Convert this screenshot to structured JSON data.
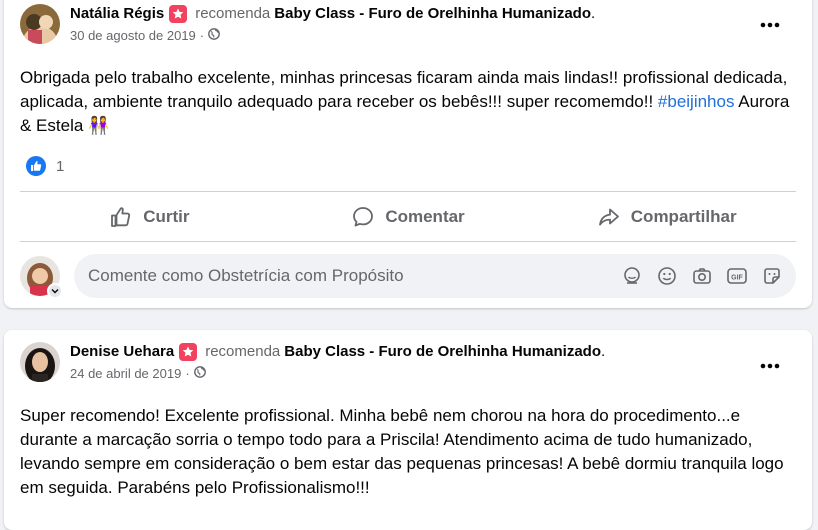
{
  "posts": [
    {
      "author": "Natália Régis",
      "verb": "recomenda",
      "page": "Baby Class - Furo de Orelhinha Humanizado",
      "period": ".",
      "date": "30 de agosto de 2019",
      "separator": "·",
      "text_before": "Obrigada pelo trabalho excelente, minhas princesas ficaram ainda mais lindas!! profissional dedicada, aplicada, ambiente tranquilo adequado para receber os bebês!!! super recomemdo!! ",
      "hashtag": "#beijinhos",
      "text_after": " Aurora & Estela ",
      "emoji": "👭",
      "reaction_count": "1",
      "actions": {
        "like": "Curtir",
        "comment": "Comentar",
        "share": "Compartilhar"
      },
      "comment_placeholder": "Comente como Obstetrícia com Propósito"
    },
    {
      "author": "Denise Uehara",
      "verb": "recomenda",
      "page": "Baby Class - Furo de Orelhinha Humanizado",
      "period": ".",
      "date": "24 de abril de 2019",
      "separator": "·",
      "text": "Super recomendo! Excelente profissional. Minha bebê nem chorou na hora do procedimento...e durante a marcação sorria o tempo todo para a Priscila! Atendimento acima de tudo humanizado, levando sempre em consideração o bem estar das pequenas princesas! A bebê dormiu tranquila logo em seguida. Parabéns pelo Profissionalismo!!!"
    }
  ],
  "colors": {
    "background": "#f0f2f5",
    "card": "#ffffff",
    "link": "#216fdb",
    "like_blue": "#1877f2",
    "recommend_badge": "#f3425f",
    "secondary_text": "#65676b"
  },
  "icons": {
    "recommend": "star-badge-icon",
    "audience": "globe-icon",
    "more": "more-horizontal-icon",
    "like_reaction": "thumbs-up-icon",
    "like_action": "like-outline-icon",
    "comment_action": "comment-bubble-icon",
    "share_action": "share-arrow-icon",
    "composer": [
      "avatar-sticker-icon",
      "emoji-icon",
      "camera-icon",
      "gif-icon",
      "sticker-icon"
    ]
  }
}
